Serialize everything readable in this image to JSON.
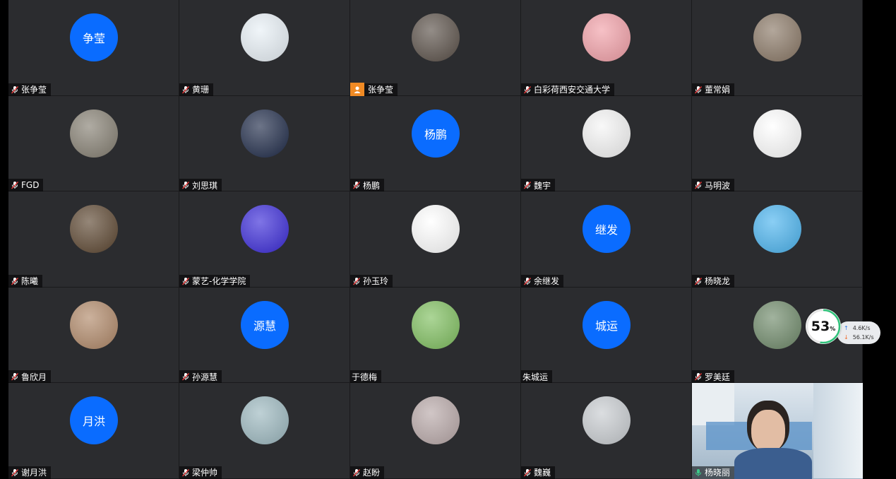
{
  "participants": [
    {
      "name": "张争莹",
      "avatar_text": "争莹",
      "avatar_kind": "text"
    },
    {
      "name": "黄珊",
      "avatar_kind": "image",
      "icon": "cartoon-girl-avatar",
      "bg": "#e8f0f6"
    },
    {
      "name": "张争莹",
      "avatar_kind": "image",
      "icon": "dog-on-swing-avatar",
      "bg": "#5a5048",
      "host": true
    },
    {
      "name": "白彩荷西安交通大学",
      "avatar_kind": "image",
      "icon": "strawberry-girl-avatar",
      "bg": "#f2a0a8"
    },
    {
      "name": "董常娟",
      "avatar_kind": "image",
      "icon": "girl-photo-avatar",
      "bg": "#8a7866"
    },
    {
      "name": "FGD",
      "avatar_kind": "image",
      "icon": "street-photo-avatar",
      "bg": "#857f72"
    },
    {
      "name": "刘思琪",
      "avatar_kind": "image",
      "icon": "girl-night-photo-avatar",
      "bg": "#1e2a48"
    },
    {
      "name": "杨鹏",
      "avatar_text": "杨鹏",
      "avatar_kind": "text"
    },
    {
      "name": "魏宇",
      "avatar_kind": "image",
      "icon": "cartoon-robot-avatar",
      "bg": "#f5f5f5"
    },
    {
      "name": "马明波",
      "avatar_kind": "image",
      "icon": "winnie-pooh-avatar",
      "bg": "#ffffff"
    },
    {
      "name": "陈曦",
      "avatar_kind": "image",
      "icon": "man-eating-photo-avatar",
      "bg": "#5c4630"
    },
    {
      "name": "蒙艺-化学学院",
      "avatar_kind": "image",
      "icon": "blue-anime-avatar",
      "bg": "#3a2ad8"
    },
    {
      "name": "孙玉玲",
      "avatar_kind": "image",
      "icon": "cartoon-kid-avatar",
      "bg": "#ffffff"
    },
    {
      "name": "余继发",
      "avatar_text": "继发",
      "avatar_kind": "text"
    },
    {
      "name": "杨晓龙",
      "avatar_kind": "image",
      "icon": "blue-sky-lamp-avatar",
      "bg": "#4bb4ef"
    },
    {
      "name": "鲁欣月",
      "avatar_kind": "image",
      "icon": "hermione-avatar",
      "bg": "#b08868"
    },
    {
      "name": "孙源慧",
      "avatar_text": "源慧",
      "avatar_kind": "text"
    },
    {
      "name": "于德梅",
      "avatar_kind": "image",
      "icon": "water-drop-leaf-avatar",
      "bg": "#7fbf5f",
      "plain": true
    },
    {
      "name": "朱城运",
      "avatar_text": "城运",
      "avatar_kind": "text",
      "plain": true
    },
    {
      "name": "罗美廷",
      "avatar_kind": "image",
      "icon": "garden-path-avatar",
      "bg": "#6f8a6a"
    },
    {
      "name": "谢月洪",
      "avatar_text": "月洪",
      "avatar_kind": "text"
    },
    {
      "name": "梁仲帅",
      "avatar_kind": "image",
      "icon": "sea-sunset-avatar",
      "bg": "#9cb8bf"
    },
    {
      "name": "赵盼",
      "avatar_kind": "image",
      "icon": "cartoon-girl-umbrella-avatar",
      "bg": "#b8a8a8"
    },
    {
      "name": "魏巍",
      "avatar_kind": "image",
      "icon": "lake-mountain-avatar",
      "bg": "#c8ccd0"
    },
    {
      "name": "杨晓丽",
      "avatar_kind": "video",
      "icon": "webcam-video",
      "bg": "#b9c8d6",
      "speaking": true
    }
  ],
  "network": {
    "cpu_percent": "53",
    "percent_sign": "%",
    "upload": "4.6K/s",
    "download": "56.1K/s",
    "ring_color": "#2fc27a",
    "upload_color": "#2f7ae5",
    "download_color": "#f06a2a"
  },
  "colors": {
    "tile_bg": "#2b2c2f",
    "text_avatar_bg": "#0a6cff",
    "host_badge": "#f08a24",
    "speaking_border": "#3cc98a"
  }
}
